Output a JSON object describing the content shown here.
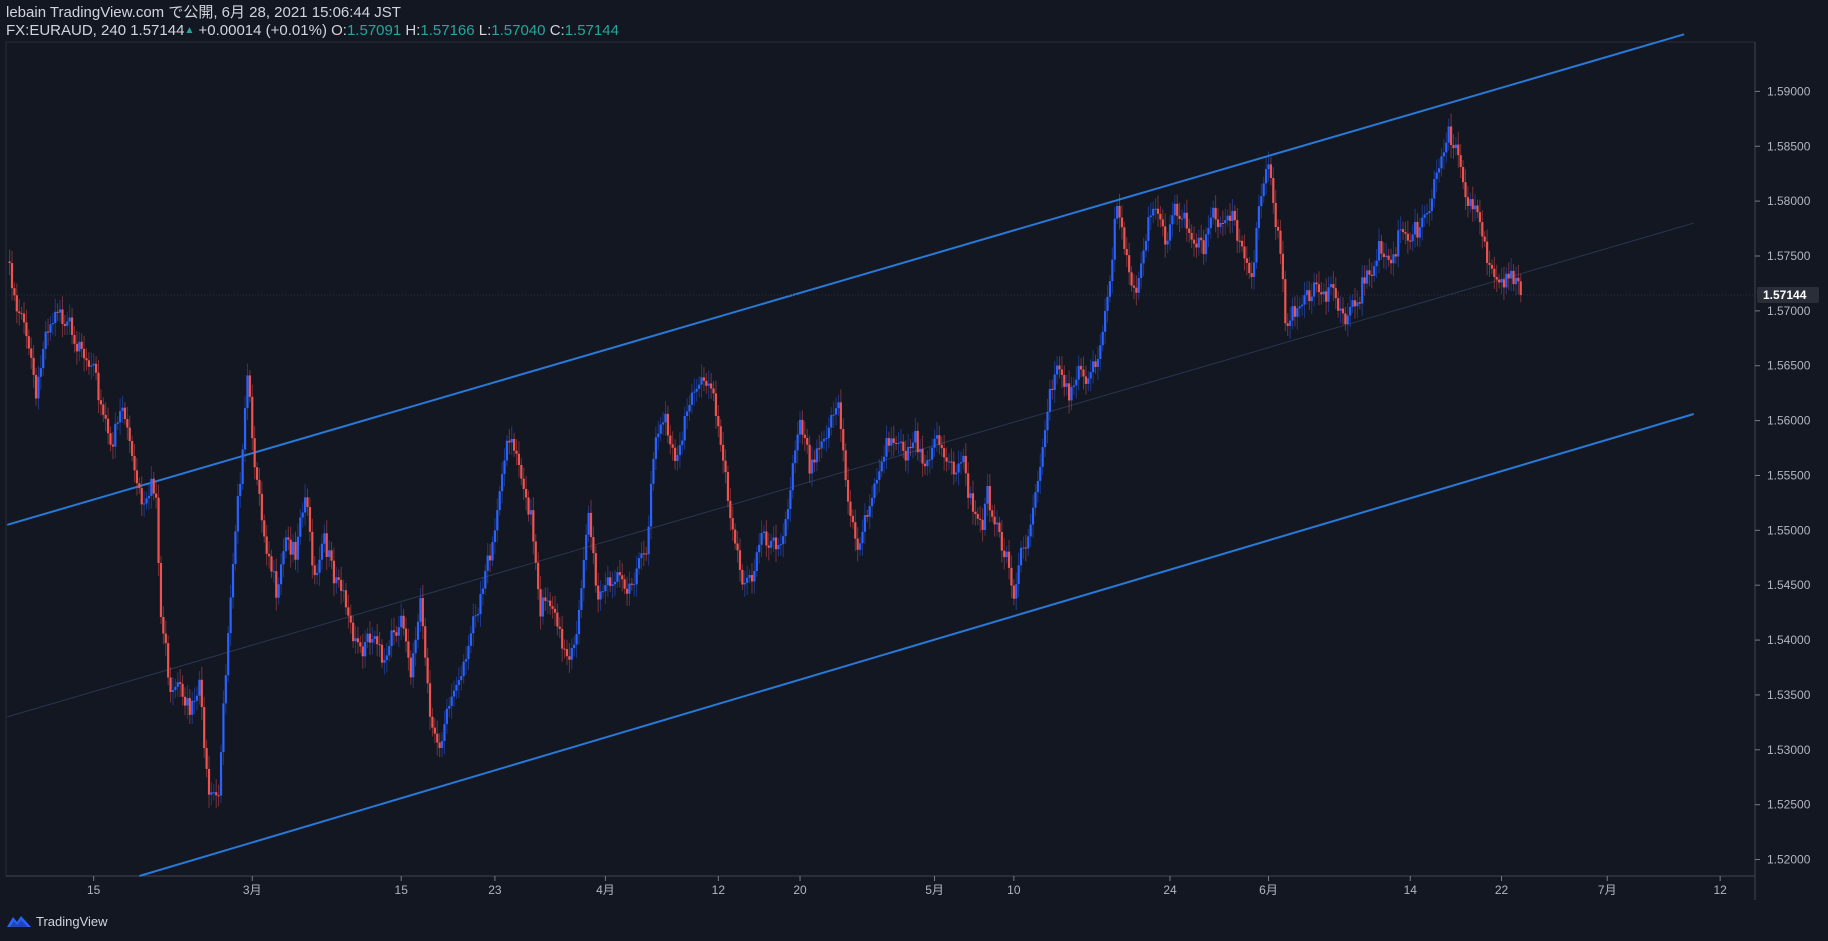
{
  "header": {
    "line1": "lebain TradingView.com で公開, 6月 28, 2021 15:06:44 JST",
    "symbol_line": "FX:EURAUD, 240 1.57144",
    "change": "+0.00014 (+0.01%)",
    "o_label": "O:",
    "o_value": "1.57091",
    "h_label": "H:",
    "h_value": "1.57166",
    "l_label": "L:",
    "l_value": "1.57040",
    "c_label": "C:",
    "c_value": "1.57144"
  },
  "footer": {
    "brand": "TradingView"
  },
  "colors": {
    "background": "#131722",
    "up": "#2962ff",
    "down": "#ef5350",
    "channel": "#2979d8",
    "axis_text": "#b2b5be",
    "ohlc_value": "#26a69a"
  },
  "chart_data": {
    "type": "candlestick",
    "symbol": "FX:EURAUD",
    "interval": "240",
    "last_price": "1.57144",
    "ylim": [
      1.5185,
      1.5945
    ],
    "y_ticks": [
      "1.52000",
      "1.52500",
      "1.53000",
      "1.53500",
      "1.54000",
      "1.54500",
      "1.55000",
      "1.55500",
      "1.56000",
      "1.56500",
      "1.57000",
      "1.57500",
      "1.58000",
      "1.58500",
      "1.59000"
    ],
    "x_ticks": [
      "15",
      "3月",
      "15",
      "23",
      "4月",
      "12",
      "20",
      "5月",
      "10",
      "24",
      "6月",
      "14",
      "22",
      "7月",
      "12"
    ],
    "x_tick_index": [
      36,
      102,
      164,
      203,
      249,
      296,
      330,
      386,
      419,
      484,
      525,
      584,
      622,
      666,
      713
    ],
    "bars_total": 728,
    "series_points": [
      [
        0,
        1.5745
      ],
      [
        4,
        1.5695
      ],
      [
        8,
        1.5685
      ],
      [
        12,
        1.563
      ],
      [
        16,
        1.567
      ],
      [
        20,
        1.569
      ],
      [
        26,
        1.57
      ],
      [
        30,
        1.566
      ],
      [
        36,
        1.564
      ],
      [
        40,
        1.561
      ],
      [
        44,
        1.558
      ],
      [
        48,
        1.561
      ],
      [
        52,
        1.557
      ],
      [
        56,
        1.553
      ],
      [
        60,
        1.5545
      ],
      [
        62,
        1.552
      ],
      [
        64,
        1.542
      ],
      [
        68,
        1.536
      ],
      [
        72,
        1.537
      ],
      [
        76,
        1.533
      ],
      [
        80,
        1.5355
      ],
      [
        84,
        1.527
      ],
      [
        88,
        1.5265
      ],
      [
        92,
        1.54
      ],
      [
        96,
        1.552
      ],
      [
        100,
        1.565
      ],
      [
        104,
        1.554
      ],
      [
        108,
        1.547
      ],
      [
        112,
        1.545
      ],
      [
        116,
        1.55
      ],
      [
        120,
        1.547
      ],
      [
        124,
        1.553
      ],
      [
        128,
        1.546
      ],
      [
        132,
        1.55
      ],
      [
        136,
        1.545
      ],
      [
        140,
        1.544
      ],
      [
        144,
        1.541
      ],
      [
        148,
        1.539
      ],
      [
        152,
        1.54
      ],
      [
        156,
        1.538
      ],
      [
        160,
        1.541
      ],
      [
        164,
        1.542
      ],
      [
        168,
        1.536
      ],
      [
        172,
        1.544
      ],
      [
        176,
        1.534
      ],
      [
        180,
        1.529
      ],
      [
        184,
        1.534
      ],
      [
        188,
        1.537
      ],
      [
        192,
        1.54
      ],
      [
        196,
        1.542
      ],
      [
        200,
        1.547
      ],
      [
        204,
        1.552
      ],
      [
        206,
        1.556
      ],
      [
        210,
        1.558
      ],
      [
        214,
        1.554
      ],
      [
        218,
        1.552
      ],
      [
        222,
        1.543
      ],
      [
        226,
        1.543
      ],
      [
        230,
        1.54
      ],
      [
        234,
        1.539
      ],
      [
        238,
        1.542
      ],
      [
        242,
        1.551
      ],
      [
        246,
        1.544
      ],
      [
        250,
        1.546
      ],
      [
        254,
        1.545
      ],
      [
        258,
        1.544
      ],
      [
        262,
        1.547
      ],
      [
        266,
        1.549
      ],
      [
        270,
        1.558
      ],
      [
        274,
        1.56
      ],
      [
        278,
        1.557
      ],
      [
        282,
        1.56
      ],
      [
        286,
        1.562
      ],
      [
        290,
        1.564
      ],
      [
        294,
        1.563
      ],
      [
        298,
        1.556
      ],
      [
        302,
        1.549
      ],
      [
        306,
        1.546
      ],
      [
        310,
        1.546
      ],
      [
        314,
        1.549
      ],
      [
        318,
        1.548
      ],
      [
        322,
        1.549
      ],
      [
        326,
        1.554
      ],
      [
        330,
        1.559
      ],
      [
        334,
        1.556
      ],
      [
        338,
        1.558
      ],
      [
        342,
        1.559
      ],
      [
        346,
        1.561
      ],
      [
        350,
        1.553
      ],
      [
        354,
        1.549
      ],
      [
        358,
        1.551
      ],
      [
        362,
        1.554
      ],
      [
        366,
        1.559
      ],
      [
        370,
        1.558
      ],
      [
        374,
        1.556
      ],
      [
        378,
        1.558
      ],
      [
        382,
        1.557
      ],
      [
        386,
        1.558
      ],
      [
        390,
        1.556
      ],
      [
        394,
        1.556
      ],
      [
        398,
        1.557
      ],
      [
        402,
        1.551
      ],
      [
        406,
        1.55
      ],
      [
        408,
        1.553
      ],
      [
        412,
        1.551
      ],
      [
        416,
        1.547
      ],
      [
        419,
        1.543
      ],
      [
        422,
        1.548
      ],
      [
        426,
        1.551
      ],
      [
        430,
        1.556
      ],
      [
        434,
        1.562
      ],
      [
        438,
        1.565
      ],
      [
        442,
        1.563
      ],
      [
        446,
        1.564
      ],
      [
        450,
        1.563
      ],
      [
        454,
        1.566
      ],
      [
        458,
        1.572
      ],
      [
        462,
        1.579
      ],
      [
        466,
        1.574
      ],
      [
        470,
        1.572
      ],
      [
        474,
        1.577
      ],
      [
        478,
        1.579
      ],
      [
        482,
        1.576
      ],
      [
        486,
        1.58
      ],
      [
        490,
        1.578
      ],
      [
        494,
        1.575
      ],
      [
        498,
        1.576
      ],
      [
        502,
        1.58
      ],
      [
        506,
        1.577
      ],
      [
        510,
        1.578
      ],
      [
        514,
        1.576
      ],
      [
        518,
        1.574
      ],
      [
        522,
        1.58
      ],
      [
        525,
        1.583
      ],
      [
        530,
        1.576
      ],
      [
        532,
        1.57
      ],
      [
        536,
        1.569
      ],
      [
        540,
        1.571
      ],
      [
        544,
        1.573
      ],
      [
        548,
        1.572
      ],
      [
        552,
        1.571
      ],
      [
        556,
        1.569
      ],
      [
        560,
        1.571
      ],
      [
        564,
        1.572
      ],
      [
        568,
        1.573
      ],
      [
        572,
        1.576
      ],
      [
        576,
        1.575
      ],
      [
        580,
        1.577
      ],
      [
        584,
        1.576
      ],
      [
        588,
        1.578
      ],
      [
        592,
        1.58
      ],
      [
        596,
        1.582
      ],
      [
        600,
        1.586
      ],
      [
        604,
        1.585
      ],
      [
        608,
        1.58
      ],
      [
        612,
        1.578
      ],
      [
        616,
        1.575
      ],
      [
        620,
        1.574
      ],
      [
        624,
        1.573
      ],
      [
        628,
        1.572
      ],
      [
        630,
        1.5714
      ]
    ],
    "channel_lines": [
      {
        "name": "upper",
        "points": [
          [
            0,
            1.5505
          ],
          [
            698,
            1.5952
          ]
        ]
      },
      {
        "name": "lower",
        "points": [
          [
            55,
            1.5185
          ],
          [
            702,
            1.5606
          ]
        ]
      },
      {
        "name": "mid",
        "points": [
          [
            0,
            1.533
          ],
          [
            702,
            1.578
          ]
        ]
      }
    ]
  }
}
